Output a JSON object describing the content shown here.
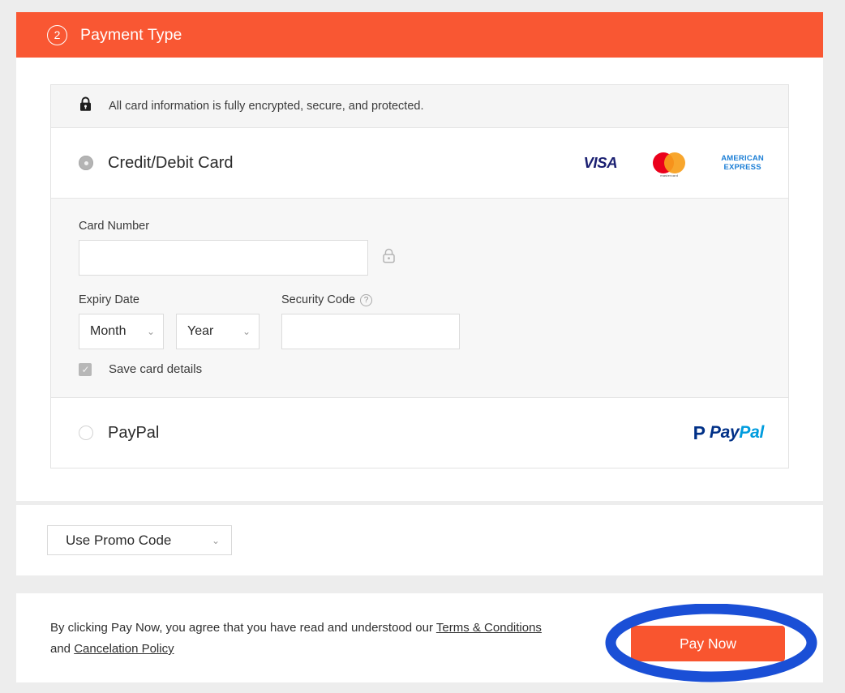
{
  "header": {
    "step_number": "2",
    "title": "Payment Type",
    "accent_color": "#f95733"
  },
  "notice": {
    "icon": "lock-icon",
    "text": "All card information is fully encrypted, secure, and protected."
  },
  "methods": {
    "credit_debit": {
      "label": "Credit/Debit Card",
      "selected": true,
      "brands": [
        {
          "name": "visa",
          "label": "VISA",
          "color": "#1a1f71"
        },
        {
          "name": "mastercard",
          "label": "mastercard",
          "color_left": "#eb001b",
          "color_right": "#f79e1b"
        },
        {
          "name": "american-express",
          "label_line1": "AMERICAN",
          "label_line2": "EXPRESS",
          "color": "#1c7fd6"
        }
      ]
    },
    "paypal": {
      "label": "PayPal",
      "selected": false,
      "logo_pay": "Pay",
      "logo_pal": "Pal",
      "logo_mark": "P",
      "color_dark": "#003087",
      "color_light": "#009cde"
    }
  },
  "card_form": {
    "card_number": {
      "label": "Card Number",
      "value": "",
      "placeholder": "",
      "trailing_icon": "lock-icon"
    },
    "expiry": {
      "label": "Expiry Date",
      "month_value": "Month",
      "year_value": "Year",
      "chevron": "⌄"
    },
    "security_code": {
      "label": "Security Code",
      "help_icon": "?",
      "value": "",
      "placeholder": ""
    },
    "save_card": {
      "label": "Save card details",
      "checked": true,
      "tick": "✓"
    }
  },
  "promo": {
    "button_label": "Use Promo Code",
    "chevron": "⌄"
  },
  "footer": {
    "legal_prefix": "By clicking Pay Now, you agree that you have read and understood our",
    "terms_link": "Terms & Conditions",
    "conjunction": "and",
    "policy_link": "Cancelation Policy",
    "pay_now_label": "Pay Now",
    "annotation_color": "#1a4fd6"
  }
}
